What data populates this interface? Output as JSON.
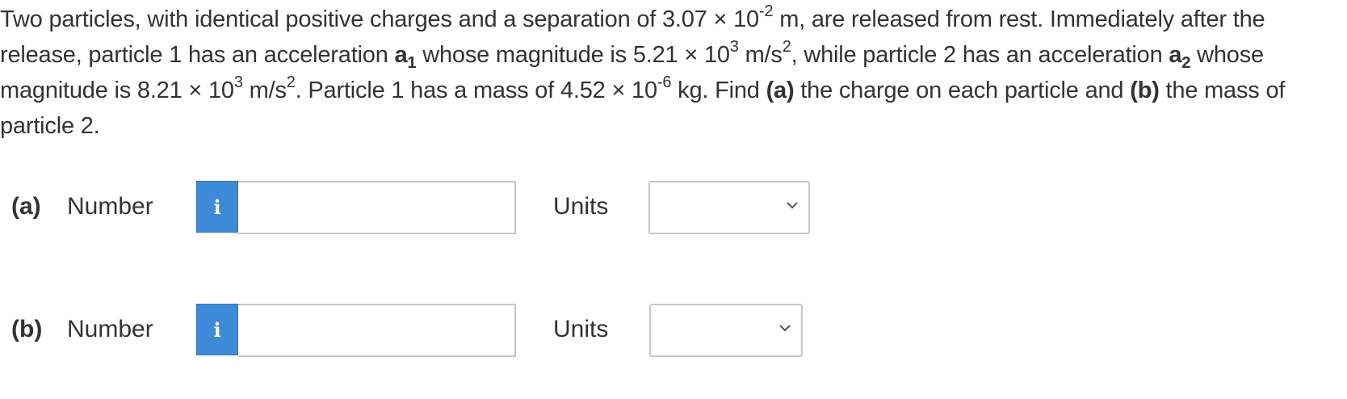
{
  "problem": {
    "t1": "Two particles, with identical positive charges and a separation of 3.07 × 10",
    "sep_exp": "-2",
    "t2": " m, are released from rest. Immediately after the release, particle 1 has an acceleration ",
    "a1_sym": "a",
    "a1_sub": "1",
    "t3": " whose magnitude is 5.21 × 10",
    "a1_exp": "3",
    "t4": " m/s",
    "a1_unit_exp": "2",
    "t5": ", while particle 2 has an acceleration ",
    "a2_sym": "a",
    "a2_sub": "2",
    "t6": " whose magnitude is 8.21 × 10",
    "a2_exp": "3",
    "t7": " m/s",
    "a2_unit_exp": "2",
    "t8": ". Particle 1 has a mass of 4.52 × 10",
    "m_exp": "-6",
    "t9": " kg. Find ",
    "part_a": "(a)",
    "t10": " the charge on each particle and ",
    "part_b": "(b)",
    "t11": " the mass of particle 2."
  },
  "answers": [
    {
      "part_label": "(a)",
      "number_label": "Number",
      "info_icon": "i",
      "value": "",
      "units_label": "Units",
      "units_selected": ""
    },
    {
      "part_label": "(b)",
      "number_label": "Number",
      "info_icon": "i",
      "value": "",
      "units_label": "Units",
      "units_selected": ""
    }
  ],
  "colors": {
    "info_button": "#3c8ad8",
    "border": "#c8c8c8",
    "text": "#333333"
  }
}
